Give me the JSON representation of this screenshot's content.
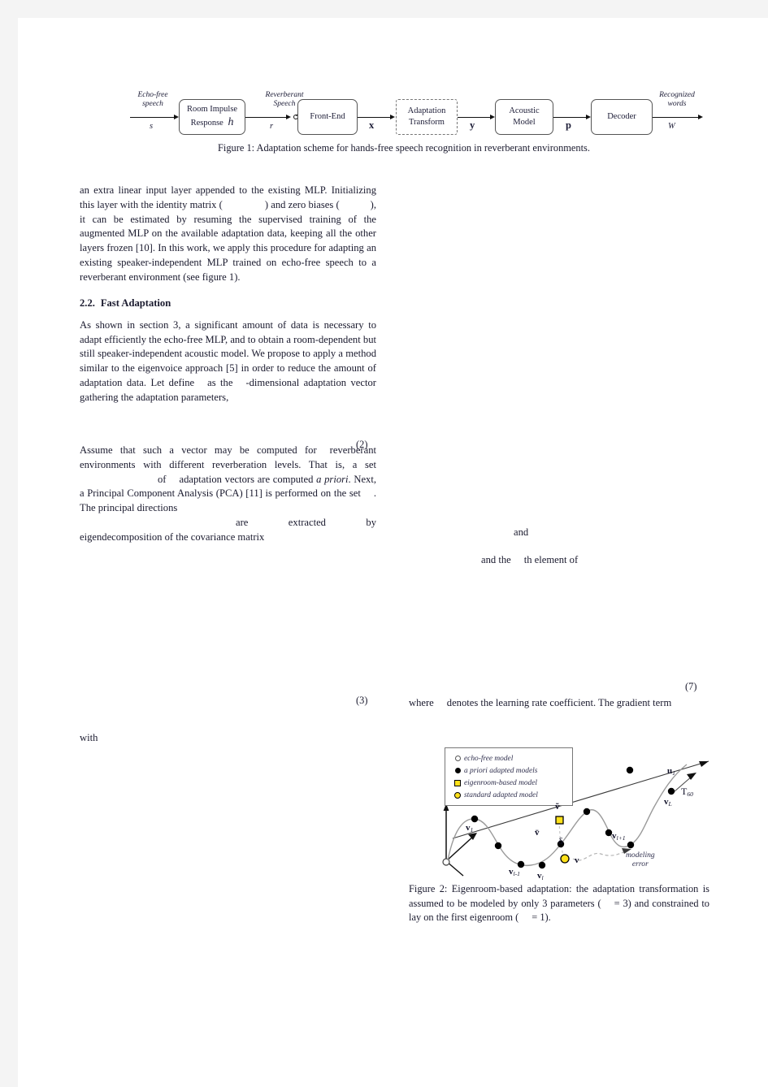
{
  "document": {
    "type": "academic-paper-page",
    "page_background": "#f4f4f4",
    "paper_background": "#ffffff"
  },
  "figure1": {
    "blocks": [
      {
        "id": "room-impulse-response",
        "line1": "Room  Impulse",
        "line2": "Response",
        "symbol": "h",
        "dashed": false
      },
      {
        "id": "front-end",
        "line1": "Front-End",
        "line2": "",
        "symbol": "",
        "dashed": false
      },
      {
        "id": "adaptation-transform",
        "line1": "Adaptation",
        "line2": "Transform",
        "symbol": "",
        "dashed": true
      },
      {
        "id": "acoustic-model",
        "line1": "Acoustic",
        "line2": "Model",
        "symbol": "",
        "dashed": false
      },
      {
        "id": "decoder",
        "line1": "Decoder",
        "line2": "",
        "symbol": "",
        "dashed": false
      }
    ],
    "annotations": {
      "input_label": "Echo-free\nspeech",
      "input_signal": "s",
      "mid_label": "Reverberant\nSpeech",
      "mid_signal": "r",
      "feature_signal": "x",
      "adapted_signal": "y",
      "posterior_signal": "p",
      "output_label": "Recognized\nwords",
      "output_signal": "W"
    },
    "caption": "Figure 1: Adaptation scheme for hands-free speech recognition in reverberant environments."
  },
  "left_column": {
    "para1_a": "an extra linear input layer appended to the existing MLP. Initializing this layer with the identity matrix (",
    "para1_b": ") and zero biases (",
    "para1_c": "), it can be estimated by resuming the supervised training of the augmented MLP on the available adaptation data, keeping all the other layers frozen [10]. In this work, we apply this procedure for adapting an existing speaker-independent MLP trained on echo-free speech to a reverberant environment (see figure 1).",
    "section_number": "2.2.",
    "section_title": "Fast Adaptation",
    "para2_a": "As shown in section 3, a significant amount of data is necessary to adapt efficiently the echo-free MLP, and to obtain a room-dependent but still speaker-independent acoustic model. We propose to apply a method similar to the eigenvoice approach [5] in order to reduce the amount of adaptation data. Let define",
    "para2_b": "as the",
    "para2_c": "-dimensional adaptation vector gathering the adaptation parameters,",
    "eq2": "(2)",
    "para3_a": "Assume that such a vector may be computed for",
    "para3_b": "reverberant environments with different reverberation levels. That is, a set",
    "para3_c": "of",
    "para3_d": "adaptation vectors are computed",
    "para3_e": "a priori",
    "para3_f": ". Next, a Principal Component Analysis (PCA) [11] is performed on the set",
    "para3_g": ". The principal directions",
    "para3_h": "are extracted by eigendecomposition of the covariance matrix",
    "eq3": "(3)",
    "with_label": "with"
  },
  "right_column": {
    "frag_and": "and",
    "frag_element_a": "and the",
    "frag_element_b": "th element of",
    "eq7": "(7)",
    "frag_where_a": "where",
    "frag_where_b": "denotes the learning rate coefficient. The gradient term"
  },
  "figure2": {
    "legend": [
      {
        "marker": "open-circle",
        "label": "echo-free  model"
      },
      {
        "marker": "filled-circle",
        "label": "a priori adapted models"
      },
      {
        "marker": "yellow-square",
        "label": "eigenroom-based  model"
      },
      {
        "marker": "yellow-circle",
        "label": "standard adapted model"
      }
    ],
    "labels": {
      "v1": "v",
      "v1_sub": "1",
      "vl_minus1": "v",
      "vl_minus1_sub": "l-1",
      "vl": "v",
      "vl_sub": "l",
      "vl_plus1": "v",
      "vl_plus1_sub": "l+1",
      "vL": "v",
      "vL_sub": "L",
      "vbar": "v̄",
      "vtilde": "ṽ",
      "vhat": "v",
      "delta": "δ",
      "u1": "u",
      "u1_sub": "1",
      "t60": "T",
      "t60_sub": "60",
      "modeling_error": "modeling\nerror"
    },
    "caption_a": "Figure 2: Eigenroom-based adaptation: the adaptation transformation is assumed to be modeled by only 3 parameters (",
    "caption_b": "= 3) and constrained to lay on the first eigenroom (",
    "caption_c": "= 1).",
    "colors": {
      "accent_yellow": "#FFE11A",
      "curve": "#8a8a8a",
      "axis": "#111111"
    }
  }
}
